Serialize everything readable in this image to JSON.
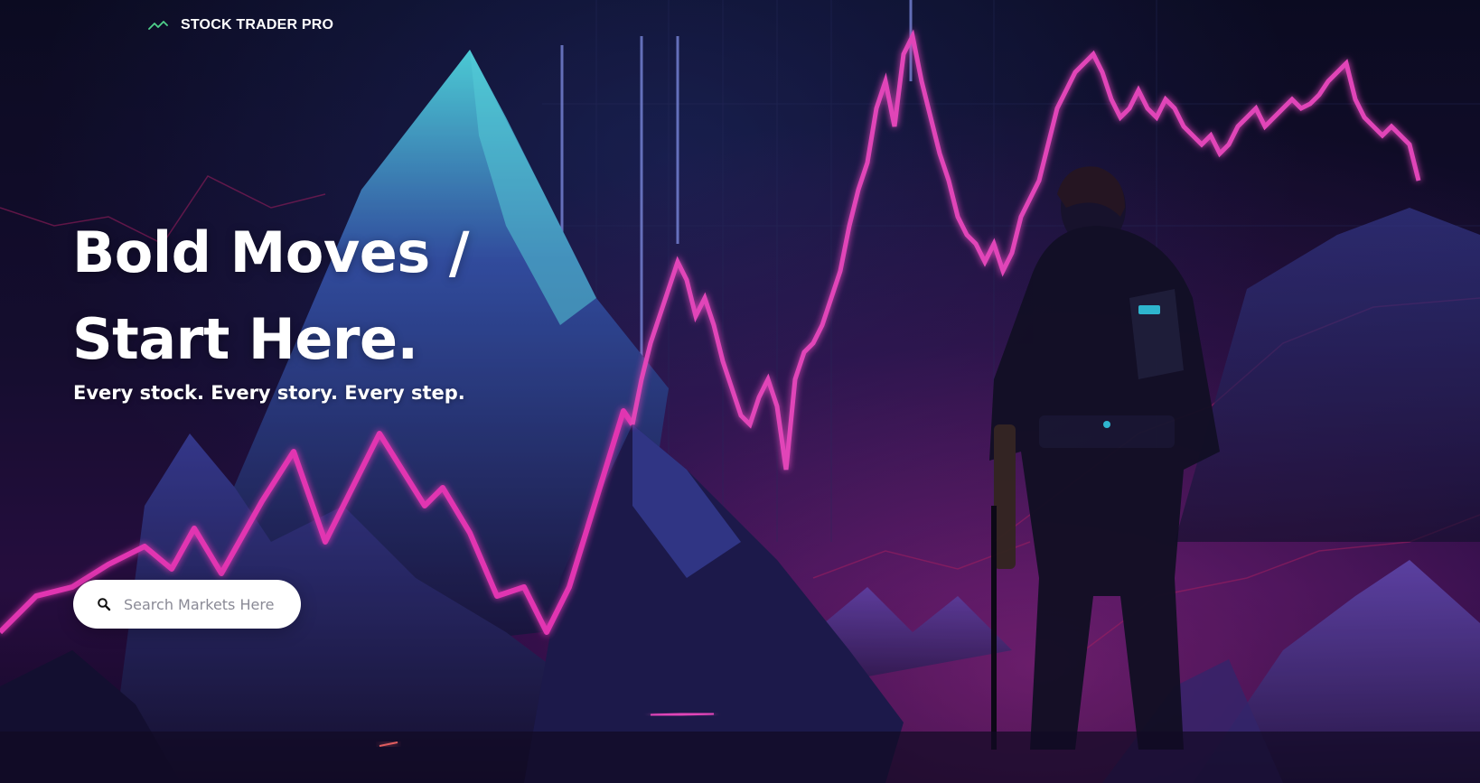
{
  "header": {
    "brand": "STOCK TRADER PRO",
    "logo_icon": "trending-line-icon"
  },
  "hero": {
    "headline_line1": "Bold Moves /",
    "headline_line2": "Start Here.",
    "tagline": "Every stock. Every story. Every step.",
    "image": "neon stock chart over mountains with standing figure"
  },
  "search": {
    "placeholder": "Search Markets Here",
    "value": "",
    "icon": "search-icon"
  },
  "colors": {
    "accent": "#4fd08a",
    "neon_pink": "#ff3cc8",
    "neon_cyan": "#34e3f0",
    "background": "#140f30"
  }
}
